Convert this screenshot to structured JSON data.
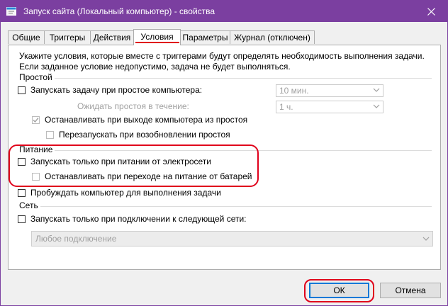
{
  "window": {
    "title": "Запуск сайта (Локальный компьютер) - свойства",
    "accent": "#7b3fa0",
    "highlight_color": "#e0001b"
  },
  "tabs": [
    {
      "label": "Общие"
    },
    {
      "label": "Триггеры"
    },
    {
      "label": "Действия"
    },
    {
      "label": "Условия",
      "active": true
    },
    {
      "label": "Параметры"
    },
    {
      "label": "Журнал (отключен)"
    }
  ],
  "intro": {
    "line1": "Укажите условия, которые вместе с триггерами будут определять необходимость выполнения задачи.",
    "line2": "Если заданное условие недопустимо, задача не будет выполняться."
  },
  "idle": {
    "group_label": "Простой",
    "start_if_idle": {
      "label": "Запускать задачу при простое компьютера:",
      "checked": false
    },
    "idle_for_value": "10 мин.",
    "wait_label": "Ожидать простоя в течение:",
    "wait_value": "1 ч.",
    "stop_if_not_idle": {
      "label": "Останавливать при выходе компьютера из простоя",
      "checked": true,
      "enabled": false
    },
    "restart_if_idle": {
      "label": "Перезапускать при возобновлении простоя",
      "checked": false,
      "enabled": false
    }
  },
  "power": {
    "group_label": "Питание",
    "ac_only": {
      "label": "Запускать только при питании от электросети",
      "checked": false
    },
    "stop_on_battery": {
      "label": "Останавливать при переходе на питание от батарей",
      "checked": false,
      "enabled": false
    },
    "wake": {
      "label": "Пробуждать компьютер для выполнения задачи",
      "checked": false
    }
  },
  "network": {
    "group_label": "Сеть",
    "network_only": {
      "label": "Запускать только при подключении к следующей сети:",
      "checked": false
    },
    "connection_value": "Любое подключение"
  },
  "buttons": {
    "ok": "ОК",
    "cancel": "Отмена"
  }
}
